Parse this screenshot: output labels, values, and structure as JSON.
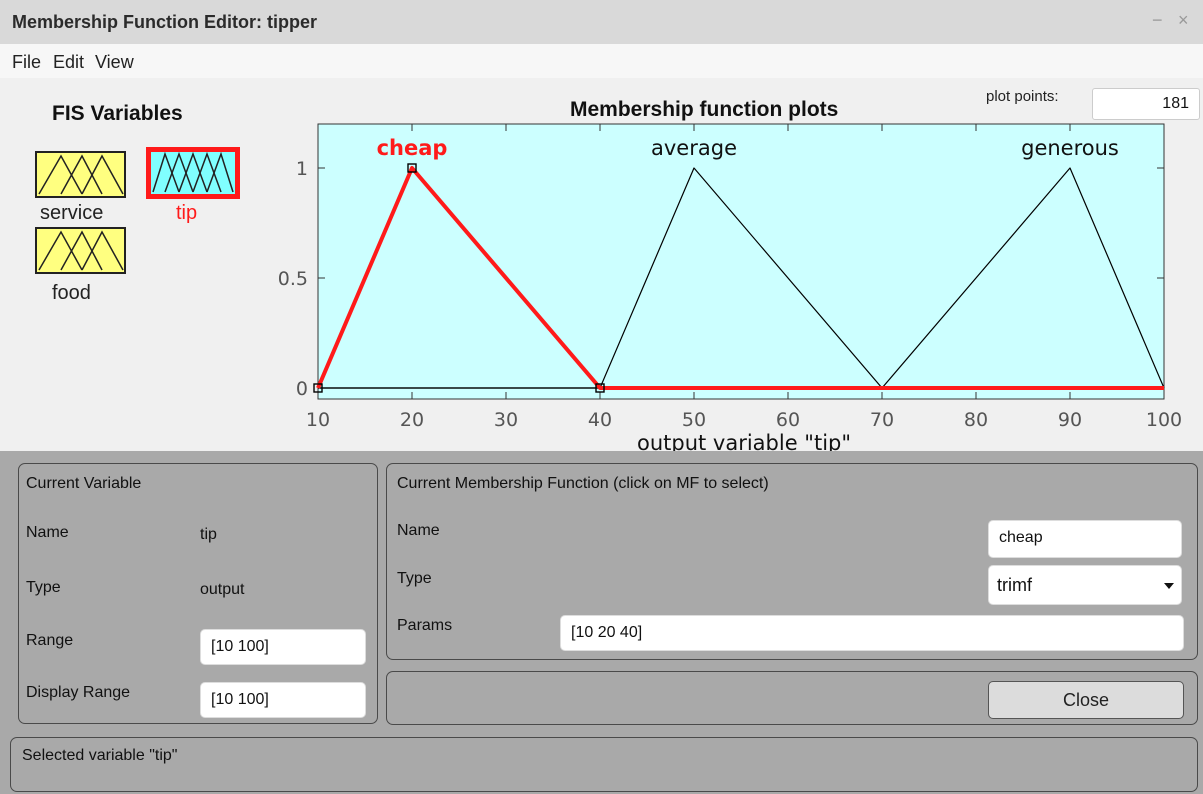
{
  "window": {
    "title": "Membership Function Editor: tipper",
    "minimize_glyph": "−",
    "close_glyph": "×"
  },
  "menu": [
    "File",
    "Edit",
    "View"
  ],
  "fis": {
    "title": "FIS Variables",
    "variables": [
      {
        "label": "service",
        "kind": "input",
        "selected": false
      },
      {
        "label": "tip",
        "kind": "output",
        "selected": true
      },
      {
        "label": "food",
        "kind": "input",
        "selected": false
      }
    ]
  },
  "plot": {
    "title": "Membership function plots",
    "plot_points_label": "plot points:",
    "plot_points_value": "181",
    "xlabel": "output variable \"tip\""
  },
  "chart_data": {
    "type": "line",
    "title": "Membership function plots",
    "xlabel": "output variable \"tip\"",
    "ylabel": "",
    "xlim": [
      10,
      100
    ],
    "ylim": [
      -0.05,
      1.2
    ],
    "xticks": [
      10,
      20,
      30,
      40,
      50,
      60,
      70,
      80,
      90,
      100
    ],
    "yticks": [
      0,
      0.5,
      1
    ],
    "series": [
      {
        "name": "cheap",
        "x": [
          10,
          20,
          40,
          100
        ],
        "y": [
          0,
          1,
          0,
          0
        ],
        "selected": true
      },
      {
        "name": "average",
        "x": [
          10,
          40,
          50,
          70,
          100
        ],
        "y": [
          0,
          0,
          1,
          0,
          0
        ],
        "selected": false
      },
      {
        "name": "generous",
        "x": [
          10,
          70,
          90,
          100
        ],
        "y": [
          0,
          0,
          1,
          0
        ],
        "selected": false
      }
    ],
    "colors": {
      "selected": "#ff1a1a",
      "normal": "#000000",
      "background": "#ccffff"
    }
  },
  "current_variable": {
    "header": "Current Variable",
    "name_label": "Name",
    "name_value": "tip",
    "type_label": "Type",
    "type_value": "output",
    "range_label": "Range",
    "range_value": "[10 100]",
    "display_range_label": "Display Range",
    "display_range_value": "[10 100]"
  },
  "current_mf": {
    "header": "Current Membership Function (click on MF to select)",
    "name_label": "Name",
    "name_value": "cheap",
    "type_label": "Type",
    "type_value": "trimf",
    "params_label": "Params",
    "params_value": "[10 20 40]"
  },
  "close_label": "Close",
  "status": "Selected variable \"tip\""
}
